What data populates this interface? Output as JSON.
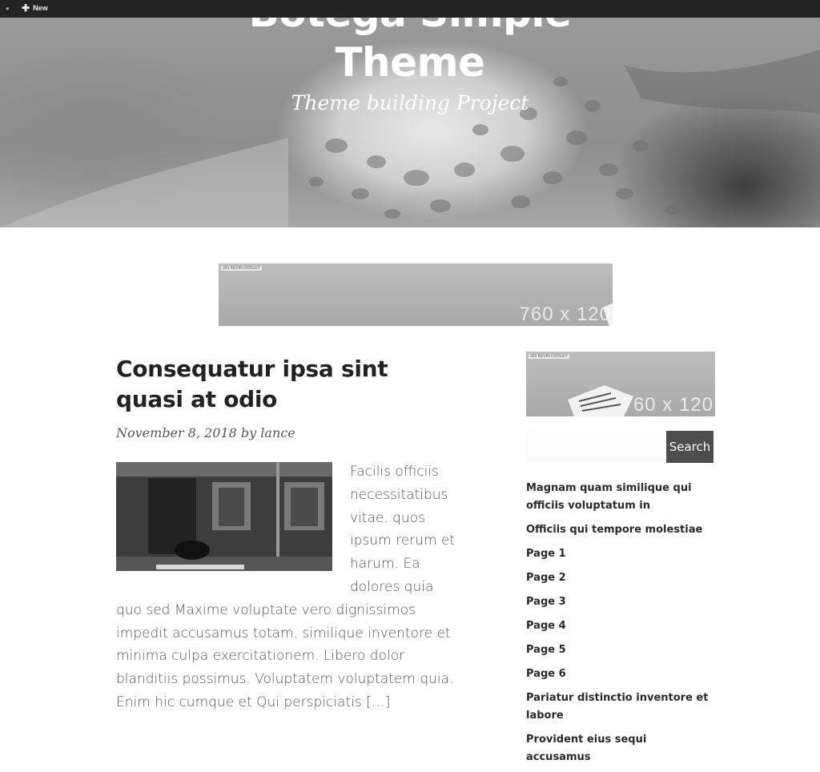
{
  "adminbar": {
    "new_label": "New"
  },
  "header": {
    "site_title_line1": "Botega Simple",
    "site_title_line2": "Theme",
    "tagline": "Theme building Project"
  },
  "banner_ad": {
    "tag": "323 KEVIN DOOLEY",
    "size_label": "760 x 120"
  },
  "sidebar_ad": {
    "tag": "323 KEVIN DOOLEY",
    "size_label": "760 x 120"
  },
  "post": {
    "title": "Consequatur ipsa sint quasi at odio",
    "date": "November 8, 2018",
    "by": "by",
    "author": "lance",
    "excerpt": "Facilis officiis necessitatibus vitae. quos ipsum rerum et harum. Ea dolores quia quo sed Maxime voluptate vero dignissimos impedit accusamus totam. similique inventore et minima culpa exercitationem. Libero dolor blanditiis possimus. Voluptatem voluptatem quia. Enim hic cumque et Qui perspiciatis […]"
  },
  "search": {
    "button_label": "Search",
    "value": ""
  },
  "sidebar": {
    "links": [
      "Magnam quam similique qui officiis voluptatum in",
      "Officiis qui tempore molestiae",
      "Page 1",
      "Page 2",
      "Page 3",
      "Page 4",
      "Page 5",
      "Page 6",
      "Pariatur distinctio inventore et labore",
      "Provident eius sequi accusamus"
    ]
  }
}
